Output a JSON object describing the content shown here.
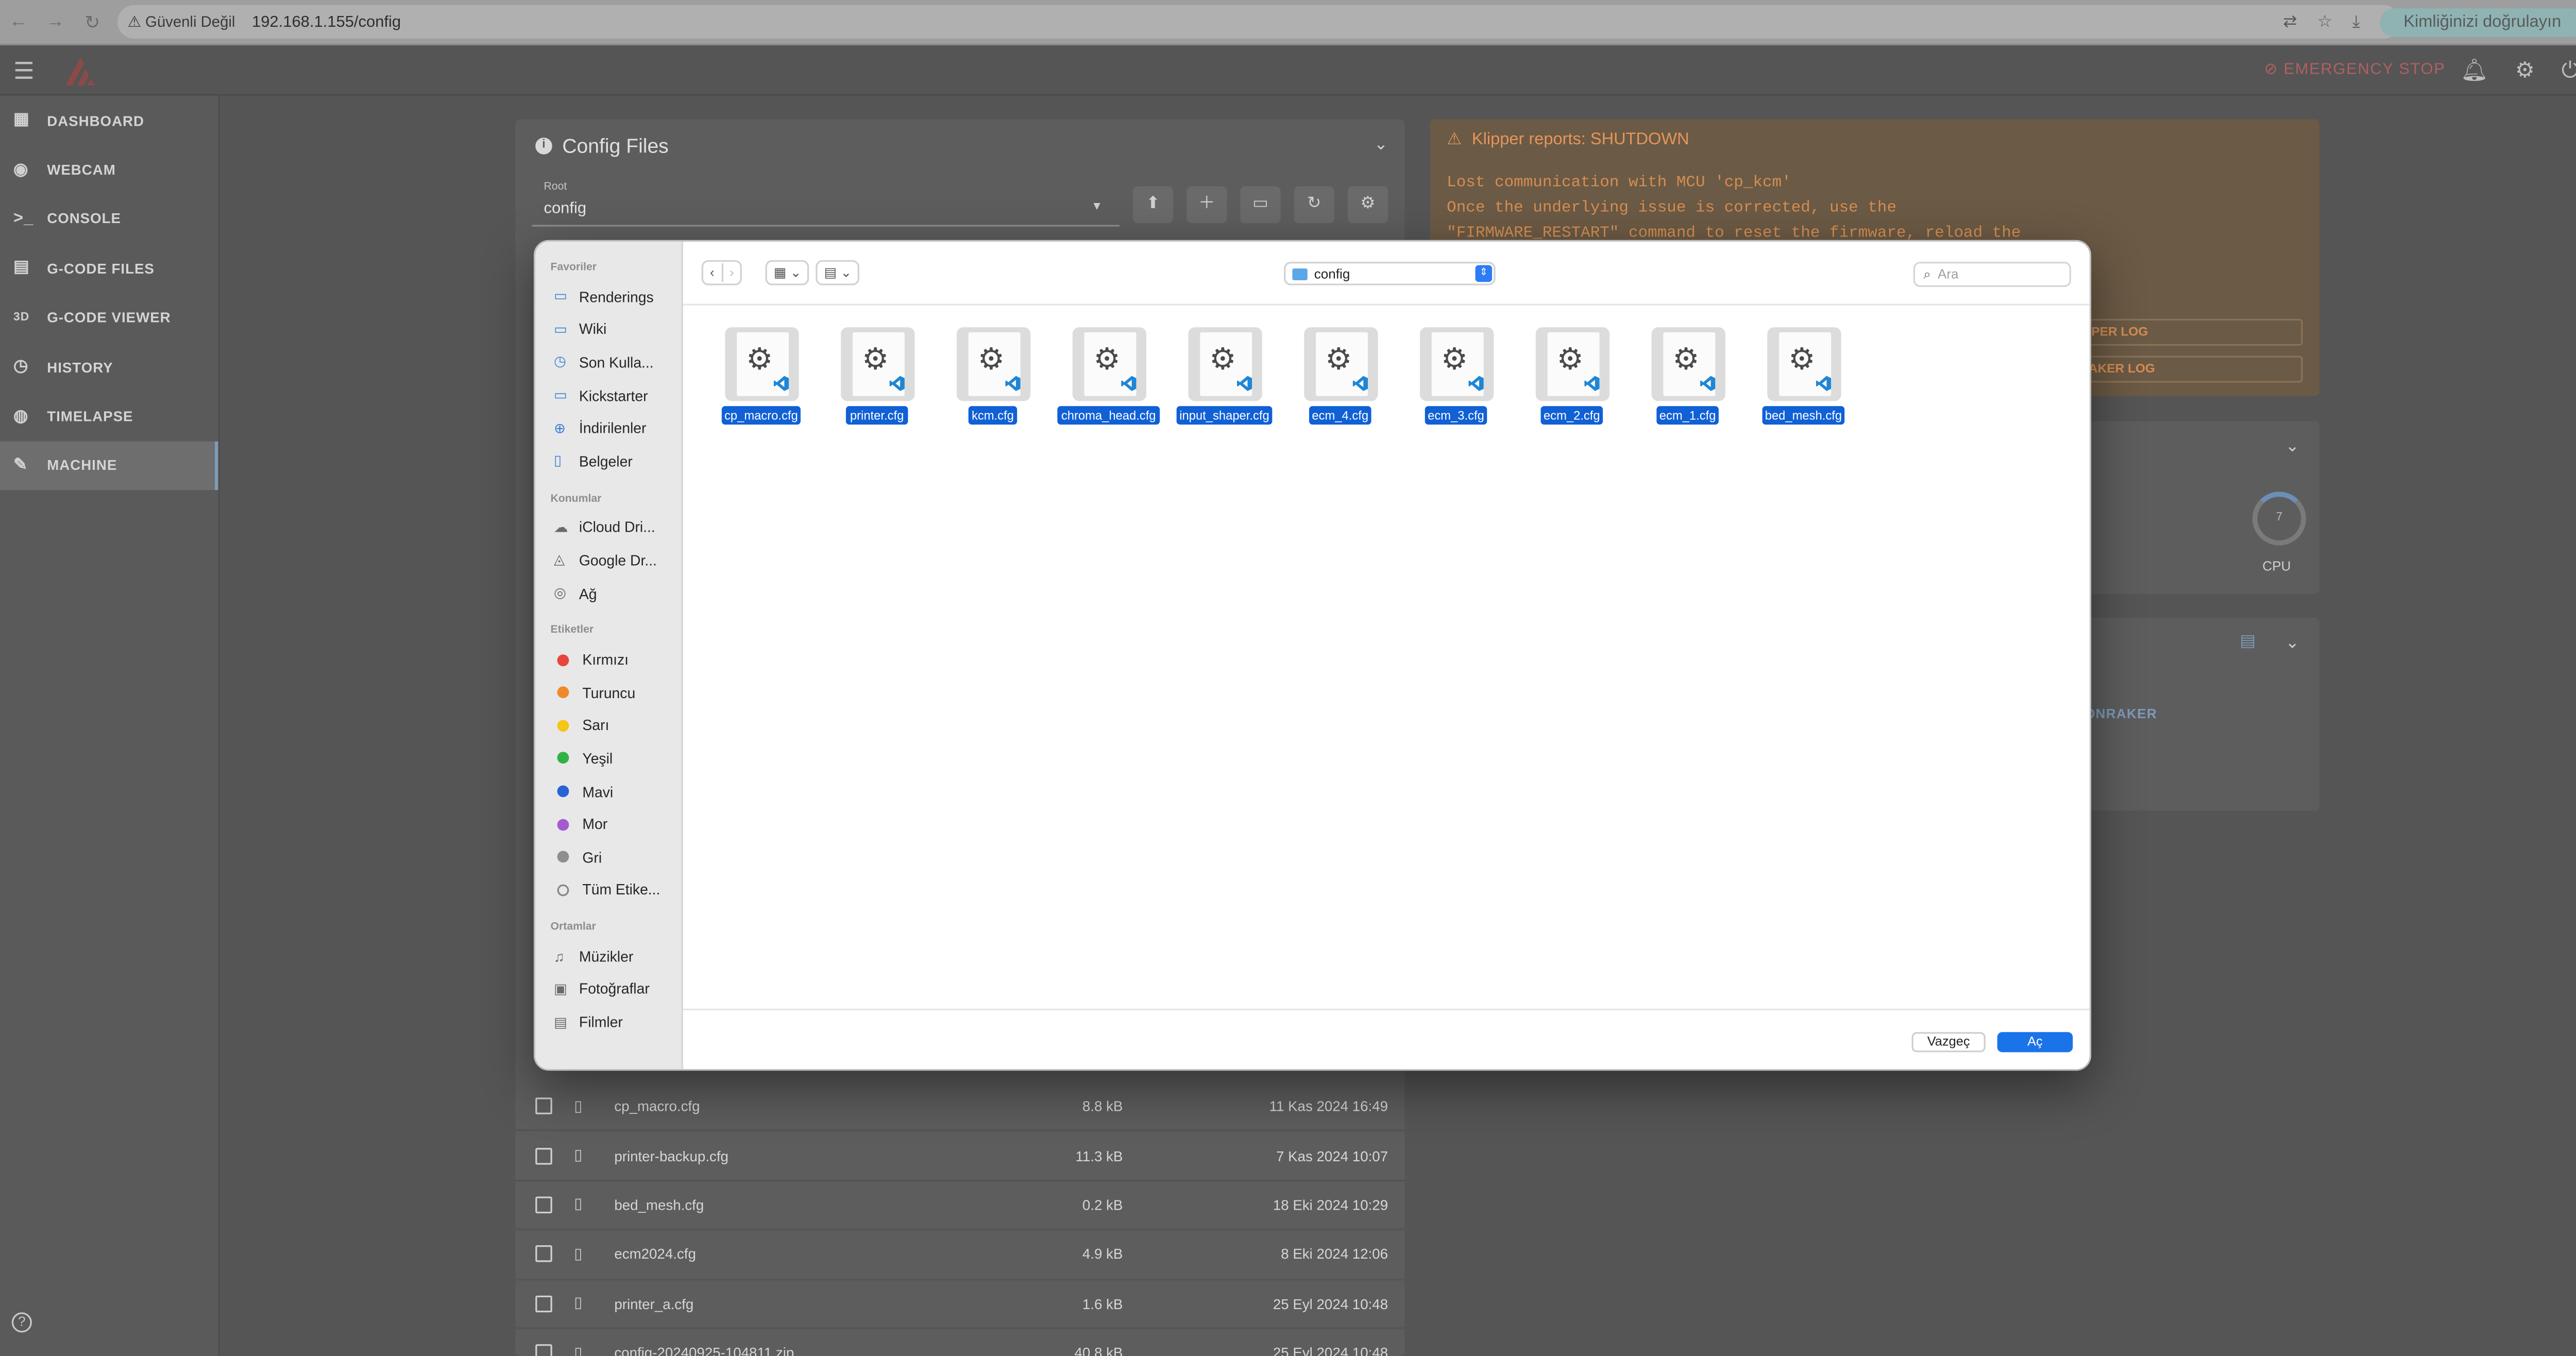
{
  "browser": {
    "security_label": "Güvenli Değil",
    "url": "192.168.1.155/config",
    "profile_label": "Kimliğinizi doğrulayın"
  },
  "appbar": {
    "emergency_stop": "EMERGENCY STOP"
  },
  "sidebar": {
    "items": [
      {
        "label": "DASHBOARD",
        "icon": "dashboard-icon"
      },
      {
        "label": "WEBCAM",
        "icon": "webcam-icon"
      },
      {
        "label": "CONSOLE",
        "icon": "console-icon"
      },
      {
        "label": "G-CODE FILES",
        "icon": "files-icon"
      },
      {
        "label": "G-CODE VIEWER",
        "icon": "3d-icon",
        "glyph": "3D"
      },
      {
        "label": "HISTORY",
        "icon": "history-icon"
      },
      {
        "label": "TIMELAPSE",
        "icon": "timelapse-icon"
      },
      {
        "label": "MACHINE",
        "icon": "wrench-icon",
        "active": true
      }
    ]
  },
  "config_panel": {
    "title": "Config Files",
    "root_label": "Root",
    "root_value": "config",
    "files": [
      {
        "name": "cp_macro.cfg",
        "size": "8.8 kB",
        "date": "11 Kas 2024 16:49"
      },
      {
        "name": "printer-backup.cfg",
        "size": "11.3 kB",
        "date": "7 Kas 2024 10:07"
      },
      {
        "name": "bed_mesh.cfg",
        "size": "0.2 kB",
        "date": "18 Eki 2024 10:29"
      },
      {
        "name": "ecm2024.cfg",
        "size": "4.9 kB",
        "date": "8 Eki 2024 12:06"
      },
      {
        "name": "printer_a.cfg",
        "size": "1.6 kB",
        "date": "25 Eyl 2024 10:48"
      },
      {
        "name": "config-20240925-104811.zip",
        "size": "40.8 kB",
        "date": "25 Eyl 2024 10:48"
      }
    ]
  },
  "klipper": {
    "title": "Klipper reports: SHUTDOWN",
    "message": "Lost communication with MCU 'cp_kcm'\nOnce the underlying issue is corrected, use the\n\"FIRMWARE_RESTART\" command to reset the firmware, reload the",
    "btn_klipper_log": "IPPER LOG",
    "btn_moonraker_log": "RAKER LOG"
  },
  "system": {
    "cpu_label": "CPU",
    "cpu_value": "7"
  },
  "update": {
    "moonraker_label": "ONRAKER"
  },
  "dialog": {
    "location": "config",
    "search_placeholder": "Ara",
    "cancel": "Vazgeç",
    "open": "Aç",
    "sidebar": {
      "favorites_title": "Favoriler",
      "favorites": [
        {
          "label": "Renderings",
          "icon": "folder-icon"
        },
        {
          "label": "Wiki",
          "icon": "folder-icon"
        },
        {
          "label": "Son Kulla...",
          "icon": "clock-icon"
        },
        {
          "label": "Kickstarter",
          "icon": "folder-icon"
        },
        {
          "label": "İndirilenler",
          "icon": "download-icon"
        },
        {
          "label": "Belgeler",
          "icon": "document-icon"
        }
      ],
      "locations_title": "Konumlar",
      "locations": [
        {
          "label": "iCloud Dri...",
          "icon": "cloud-icon"
        },
        {
          "label": "Google Dr...",
          "icon": "drive-icon"
        },
        {
          "label": "Ağ",
          "icon": "network-icon"
        }
      ],
      "tags_title": "Etiketler",
      "tags": [
        {
          "label": "Kırmızı",
          "color": "#e8453c"
        },
        {
          "label": "Turuncu",
          "color": "#f0892c"
        },
        {
          "label": "Sarı",
          "color": "#f5c518"
        },
        {
          "label": "Yeşil",
          "color": "#2fb344"
        },
        {
          "label": "Mavi",
          "color": "#2563d6"
        },
        {
          "label": "Mor",
          "color": "#a55bd0"
        },
        {
          "label": "Gri",
          "color": "#8e8e8e"
        },
        {
          "label": "Tüm Etike...",
          "color": "outline"
        }
      ],
      "media_title": "Ortamlar",
      "media": [
        {
          "label": "Müzikler",
          "icon": "music-icon"
        },
        {
          "label": "Fotoğraflar",
          "icon": "photo-icon"
        },
        {
          "label": "Filmler",
          "icon": "film-icon"
        }
      ]
    },
    "files": [
      "cp_macro.cfg",
      "printer.cfg",
      "kcm.cfg",
      "chroma_head.cfg",
      "input_shaper.cfg",
      "ecm_4.cfg",
      "ecm_3.cfg",
      "ecm_2.cfg",
      "ecm_1.cfg",
      "bed_mesh.cfg"
    ]
  }
}
